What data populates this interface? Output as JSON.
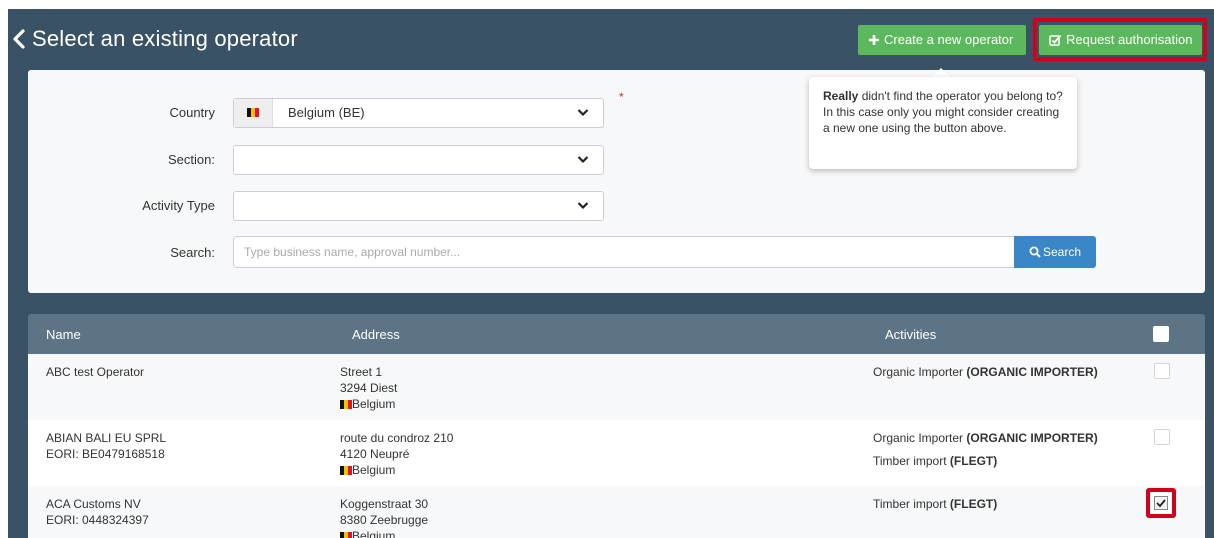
{
  "header": {
    "title": "Select an existing operator",
    "create_button": "Create a new operator",
    "request_button": "Request authorisation"
  },
  "filters": {
    "country_label": "Country",
    "country_value": "Belgium (BE)",
    "required_mark": "*",
    "section_label": "Section:",
    "activity_label": "Activity Type",
    "search_label": "Search:",
    "search_placeholder": "Type business name, approval number...",
    "search_button": "Search"
  },
  "tooltip": {
    "bold": "Really",
    "text": " didn't find the operator you belong to? In this case only you might consider creating a new one using the button above."
  },
  "table": {
    "headers": [
      "Name",
      "Address",
      "Activities"
    ],
    "rows": [
      {
        "name": "ABC test Operator",
        "eori": "",
        "street": "Street 1",
        "city": "3294 Diest",
        "country": "Belgium",
        "activities": [
          {
            "label": "Organic Importer ",
            "code": "(ORGANIC IMPORTER)"
          }
        ],
        "checked": false
      },
      {
        "name": "ABIAN BALI EU SPRL",
        "eori": "EORI: BE0479168518",
        "street": "route du condroz 210",
        "city": "4120 Neupré",
        "country": "Belgium",
        "activities": [
          {
            "label": "Organic Importer ",
            "code": "(ORGANIC IMPORTER)"
          },
          {
            "label": "Timber import ",
            "code": "(FLEGT)"
          }
        ],
        "checked": false
      },
      {
        "name": "ACA Customs NV",
        "eori": "EORI: 0448324397",
        "street": "Koggenstraat 30",
        "city": "8380 Zeebrugge",
        "country": "Belgium",
        "activities": [
          {
            "label": "Timber import ",
            "code": "(FLEGT)"
          }
        ],
        "checked": true
      }
    ]
  },
  "colors": {
    "header_bg": "#3a5266",
    "green_button": "#5cb85c",
    "search_button": "#3a87c8",
    "highlight": "#d0021b",
    "table_header": "#5d7487"
  }
}
